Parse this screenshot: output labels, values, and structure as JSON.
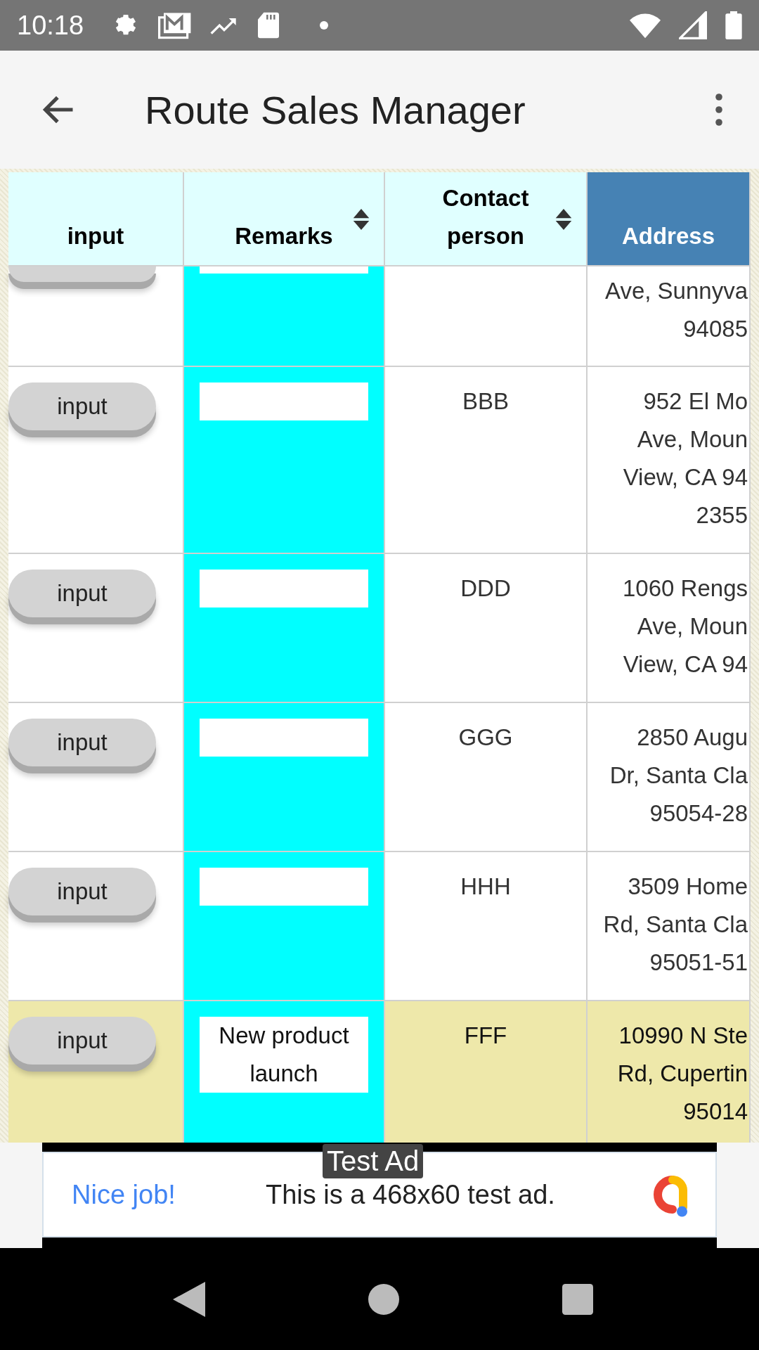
{
  "status_bar": {
    "time": "10:18"
  },
  "app_bar": {
    "title": "Route Sales Manager"
  },
  "table": {
    "columns": [
      {
        "label": "input",
        "sortable": false,
        "selected": false
      },
      {
        "label": "Remarks",
        "sortable": true,
        "selected": false
      },
      {
        "label": "Contact person",
        "sortable": true,
        "selected": false
      },
      {
        "label": "Address",
        "sortable": false,
        "selected": true
      }
    ],
    "rows": [
      {
        "kind": "cut",
        "selected": false,
        "address": [
          "Ave, Sunnyva",
          "94085"
        ]
      },
      {
        "kind": "full",
        "selected": false,
        "button": "input",
        "remarks": "",
        "contact": "BBB",
        "address": [
          "952 El Mo",
          "Ave, Moun",
          "View, CA 94",
          "2355"
        ]
      },
      {
        "kind": "full",
        "selected": false,
        "button": "input",
        "remarks": "",
        "contact": "DDD",
        "address": [
          "1060 Rengs",
          "Ave, Moun",
          "View, CA 94"
        ]
      },
      {
        "kind": "full",
        "selected": false,
        "button": "input",
        "remarks": "",
        "contact": "GGG",
        "address": [
          "2850 Augu",
          "Dr, Santa Cla",
          "95054-28"
        ]
      },
      {
        "kind": "full",
        "selected": false,
        "button": "input",
        "remarks": "",
        "contact": "HHH",
        "address": [
          "3509 Home",
          "Rd, Santa Cla",
          "95051-51"
        ]
      },
      {
        "kind": "full",
        "selected": true,
        "button": "input",
        "remarks": "New product launch",
        "contact": "FFF",
        "address": [
          "10990 N Ste",
          "Rd, Cupertin",
          "95014"
        ]
      }
    ]
  },
  "ad": {
    "label": "Test Ad",
    "headline": "Nice job!",
    "body": "This is a 468x60 test ad."
  }
}
